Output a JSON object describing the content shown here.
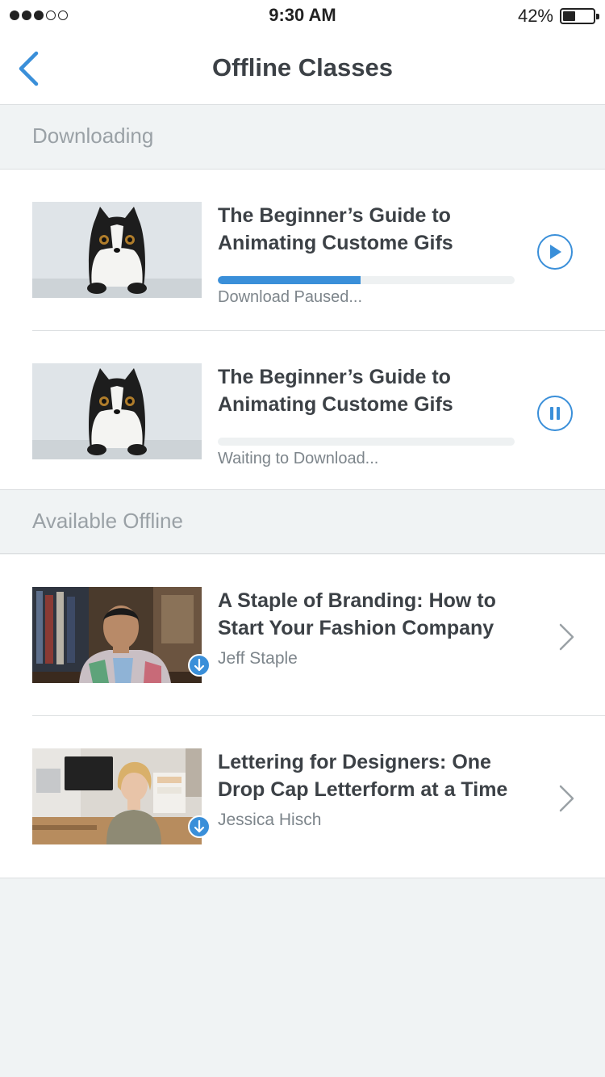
{
  "status_bar": {
    "time": "9:30 AM",
    "battery_percent": "42%",
    "battery_level": 0.42,
    "signal_bars_filled": 3,
    "signal_bars_total": 5
  },
  "nav": {
    "title": "Offline Classes",
    "back_icon": "chevron-left-icon"
  },
  "colors": {
    "accent": "#3a8fd9",
    "background": "#f0f3f4",
    "title_text": "#3c4146",
    "secondary_text": "#7d858b",
    "section_text": "#9aa1a6"
  },
  "downloading": {
    "header": "Downloading",
    "items": [
      {
        "title_line1": "The Beginner’s Guide to",
        "title_line2": "Animating Custome Gifs",
        "status": "Download Paused...",
        "progress": 0.48,
        "action_icon": "play-icon"
      },
      {
        "title_line1": "The Beginner’s Guide to",
        "title_line2": "Animating Custome Gifs",
        "status": "Waiting to Download...",
        "progress": 0,
        "action_icon": "pause-icon"
      }
    ]
  },
  "available_offline": {
    "header": "Available Offline",
    "items": [
      {
        "title_line1": "A Staple of Branding: How to",
        "title_line2": "Start Your Fashion Company",
        "author": "Jeff Staple",
        "badge_icon": "download-arrow-icon"
      },
      {
        "title_line1": "Lettering for Designers: One",
        "title_line2": "Drop Cap Letterform at a Time",
        "author": "Jessica Hisch",
        "badge_icon": "download-arrow-icon"
      }
    ]
  }
}
